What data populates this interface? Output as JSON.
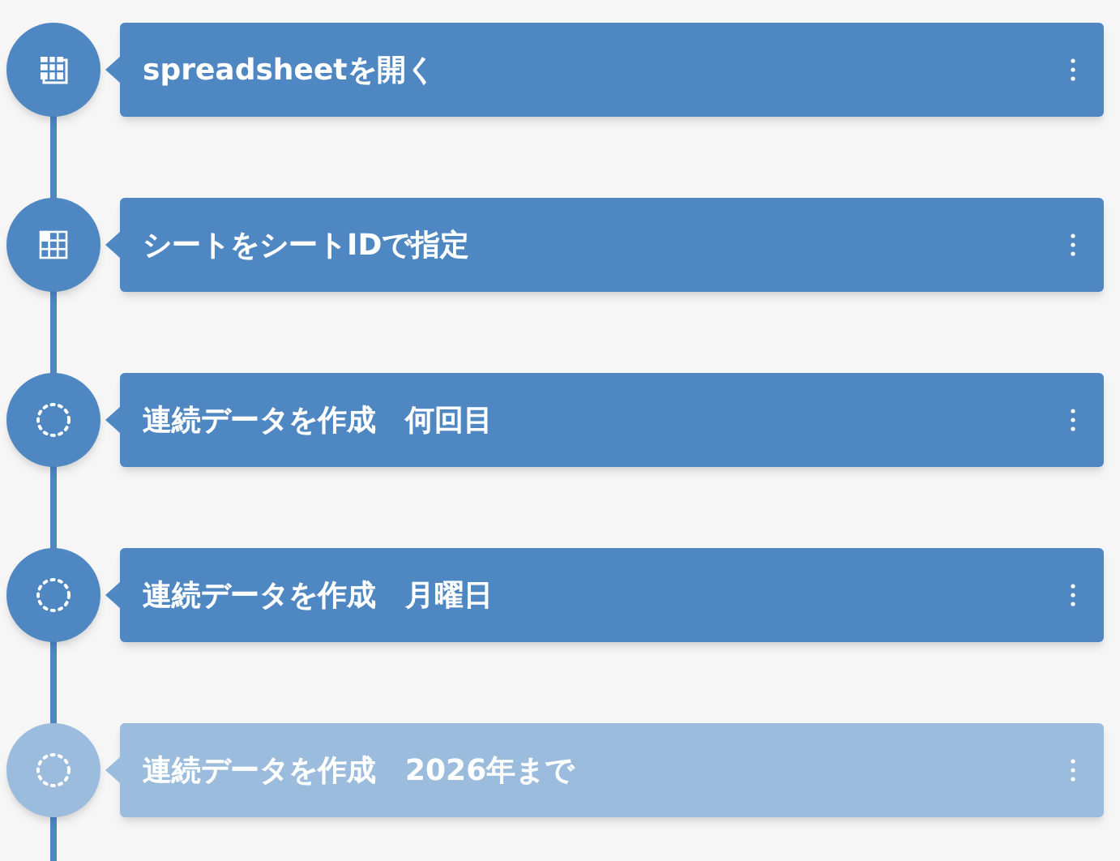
{
  "steps": [
    {
      "kind": "sheets",
      "label": "spreadsheetを開く",
      "disabled": false
    },
    {
      "kind": "grid",
      "label": "シートをシートIDで指定",
      "disabled": false
    },
    {
      "kind": "loop",
      "label": "連続データを作成　何回目",
      "disabled": false
    },
    {
      "kind": "loop",
      "label": "連続データを作成　月曜日",
      "disabled": false
    },
    {
      "kind": "loop",
      "label": "連続データを作成　2026年まで",
      "disabled": true
    }
  ]
}
